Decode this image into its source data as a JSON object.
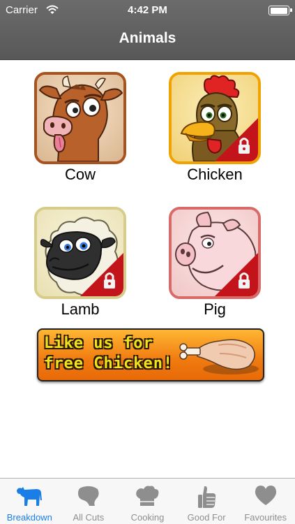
{
  "status_bar": {
    "carrier": "Carrier",
    "time": "4:42 PM",
    "icons": [
      "wifi-icon",
      "battery-icon"
    ]
  },
  "nav": {
    "title": "Animals"
  },
  "animals": [
    {
      "label": "Cow",
      "icon": "cow-icon",
      "locked": false,
      "border_color": "#a8521f"
    },
    {
      "label": "Chicken",
      "icon": "chicken-icon",
      "locked": true,
      "border_color": "#f0a300"
    },
    {
      "label": "Lamb",
      "icon": "lamb-icon",
      "locked": true,
      "border_color": "#d8cc8a"
    },
    {
      "label": "Pig",
      "icon": "pig-icon",
      "locked": true,
      "border_color": "#d86a6a"
    }
  ],
  "promo": {
    "line1": "Like us for",
    "line2": "free Chicken!",
    "icon": "drumstick-icon"
  },
  "tabs": [
    {
      "label": "Breakdown",
      "icon": "cow-silhouette-icon",
      "active": true
    },
    {
      "label": "All Cuts",
      "icon": "meat-cut-icon",
      "active": false
    },
    {
      "label": "Cooking",
      "icon": "chef-hat-icon",
      "active": false
    },
    {
      "label": "Good For",
      "icon": "thumbs-up-icon",
      "active": false
    },
    {
      "label": "Favourites",
      "icon": "heart-icon",
      "active": false
    }
  ],
  "colors": {
    "nav_bar": "#606060",
    "tab_active": "#1a7ee6",
    "tab_inactive": "#8e8e8e",
    "lock_badge": "#c4141b"
  }
}
